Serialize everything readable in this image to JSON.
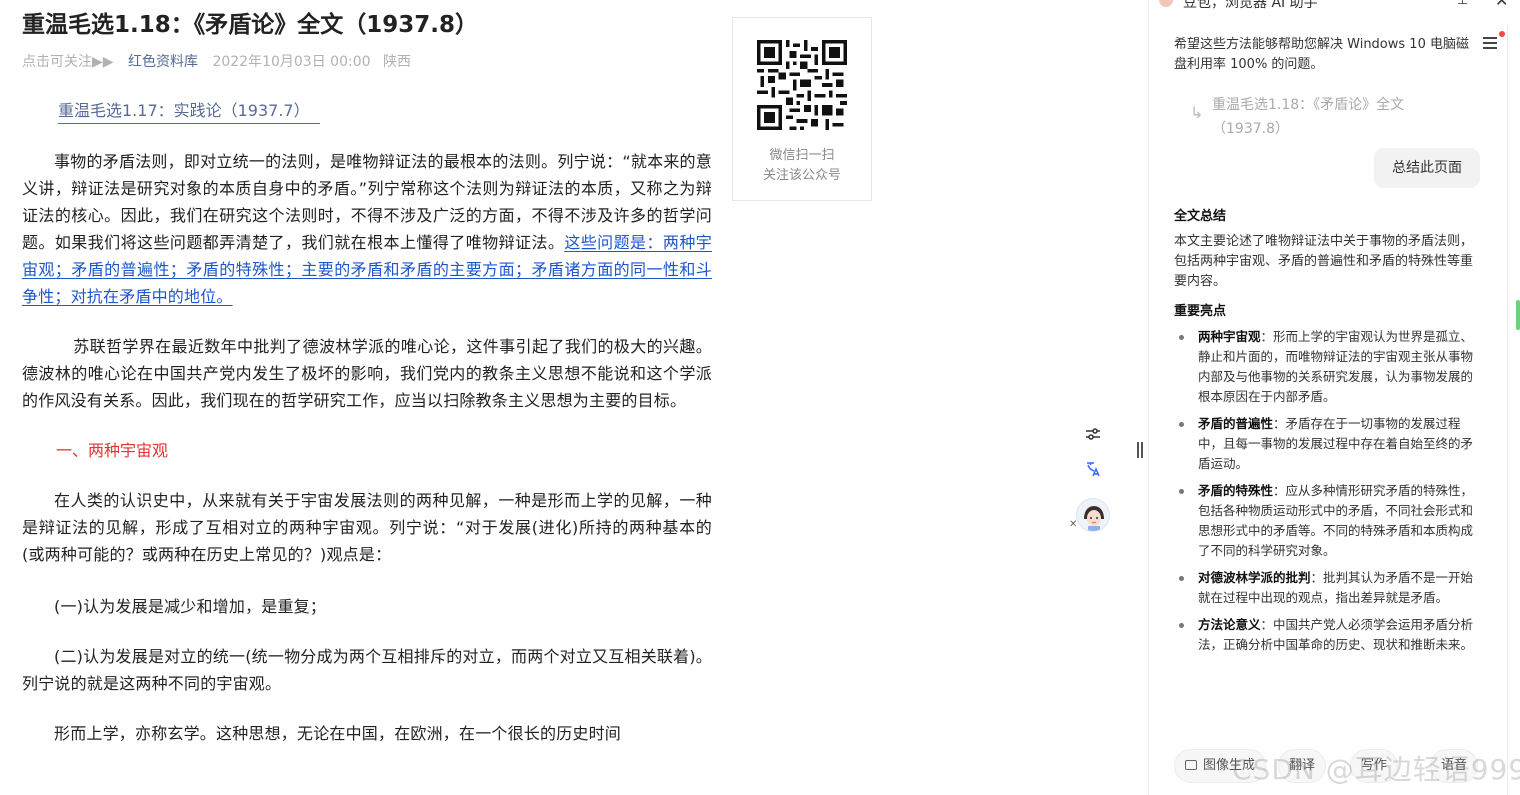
{
  "article": {
    "title": "重温毛选1.18：《矛盾论》全文（1937.8）",
    "meta": {
      "follow": "点击可关注▶▶",
      "account": "红色资料库",
      "date": "2022年10月03日 00:00",
      "location": "陕西"
    },
    "prev_link": "重温毛选1.17：实践论（1937.7）",
    "p1_plain": "事物的矛盾法则，即对立统一的法则，是唯物辩证法的最根本的法则。列宁说：“就本来的意义讲，辩证法是研究对象的本质自身中的矛盾。”列宁常称这个法则为辩证法的本质，又称之为辩证法的核心。因此，我们在研究这个法则时，不得不涉及广泛的方面，不得不涉及许多的哲学问题。如果我们将这些问题都弄清楚了，我们就在根本上懂得了唯物辩证法。",
    "p1_highlight": "这些问题是：两种宇宙观；矛盾的普遍性；矛盾的特殊性；主要的矛盾和矛盾的主要方面；矛盾诸方面的同一性和斗争性；对抗在矛盾中的地位。",
    "p2": "苏联哲学界在最近数年中批判了德波林学派的唯心论，这件事引起了我们的极大的兴趣。德波林的唯心论在中国共产党内发生了极坏的影响，我们党内的教条主义思想不能说和这个学派的作风没有关系。因此，我们现在的哲学研究工作，应当以扫除教条主义思想为主要的目标。",
    "section1": "一、两种宇宙观",
    "p3": "在人类的认识史中，从来就有关于宇宙发展法则的两种见解，一种是形而上学的见解，一种是辩证法的见解，形成了互相对立的两种宇宙观。列宁说：“对于发展(进化)所持的两种基本的(或两种可能的？或两种在历史上常见的？)观点是：",
    "p4": "(一)认为发展是减少和增加，是重复；",
    "p5": "(二)认为发展是对立的统一(统一物分成为两个互相排斥的对立，而两个对立又互相关联着)。列宁说的就是这两种不同的宇宙观。",
    "p6": "形而上学，亦称玄学。这种思想，无论在中国，在欧洲，在一个很长的历史时间"
  },
  "qr": {
    "line1": "微信扫一扫",
    "line2": "关注该公众号"
  },
  "ai": {
    "title": "豆包，浏览器 AI 助手",
    "previous_answer": "希望这些方法能够帮助您解决 Windows 10 电脑磁盘利用率 100% 的问题。",
    "ref_title": "重温毛选1.18：《矛盾论》全文（1937.8）",
    "user_message": "总结此页面",
    "summary_heading": "全文总结",
    "summary_text": "本文主要论述了唯物辩证法中关于事物的矛盾法则，包括两种宇宙观、矛盾的普遍性和矛盾的特殊性等重要内容。",
    "highlights_heading": "重要亮点",
    "highlights": [
      {
        "term": "两种宇宙观",
        "text": "：形而上学的宇宙观认为世界是孤立、静止和片面的，而唯物辩证法的宇宙观主张从事物内部及与他事物的关系研究发展，认为事物发展的根本原因在于内部矛盾。"
      },
      {
        "term": "矛盾的普遍性",
        "text": "：矛盾存在于一切事物的发展过程中，且每一事物的发展过程中存在着自始至终的矛盾运动。"
      },
      {
        "term": "矛盾的特殊性",
        "text": "：应从多种情形研究矛盾的特殊性，包括各种物质运动形式中的矛盾，不同社会形式和思想形式中的矛盾等。不同的特殊矛盾和本质构成了不同的科学研究对象。"
      },
      {
        "term": "对德波林学派的批判",
        "text": "：批判其认为矛盾不是一开始就在过程中出现的观点，指出差异就是矛盾。"
      },
      {
        "term": "方法论意义",
        "text": "：中国共产党人必须学会运用矛盾分析法，正确分析中国革命的历史、现状和推断未来。"
      }
    ],
    "chips": [
      "图像生成",
      "翻译",
      "写作",
      "语音"
    ]
  },
  "watermark": "CSDN @耳边轻语999"
}
